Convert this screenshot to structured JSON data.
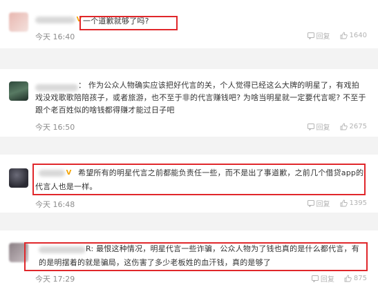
{
  "comments": [
    {
      "name_suffix": "V:",
      "text_lines": [
        "一个道歉就够了吗?"
      ],
      "time": "今天 16:40",
      "reply_label": "回复",
      "like_count": "1640"
    },
    {
      "name_suffix": "：",
      "text_lines": [
        "作为公众人物确实应该把好代言的关，个人觉得已经这么大牌的明星了，有戏拍",
        "戏没戏歌歌陪陪孩子，或者旅游，也不至于非的代言赚钱吧? 为啥当明星就一定要代言呢? 不至于",
        "跟个老百姓似的啥钱都得赚才能过日子吧"
      ],
      "time": "今天 16:50",
      "reply_label": "回复",
      "like_count": "2675"
    },
    {
      "name_suffix": "V:",
      "text_lines": [
        "希望所有的明星代言之前都能负责任一些，而不是出了事道歉，之前几个借贷app的",
        "代言人也是一样。"
      ],
      "time": "今天 16:48",
      "reply_label": "回复",
      "like_count": "1395"
    },
    {
      "name_suffix": "R:",
      "text_lines": [
        "最恨这种情况，明星代言一些诈骗，公众人物为了钱也真的是什么都代言，有",
        "的是明摆着的就是骗局，这伤害了多少老板姓的血汗钱，真的是够了"
      ],
      "time": "今天 17:29",
      "reply_label": "回复",
      "like_count": "875"
    }
  ],
  "colors": {
    "highlight_box": "#e0262a",
    "vip_badge": "#f5a400",
    "text": "#333333",
    "meta": "#8c8c8c"
  }
}
